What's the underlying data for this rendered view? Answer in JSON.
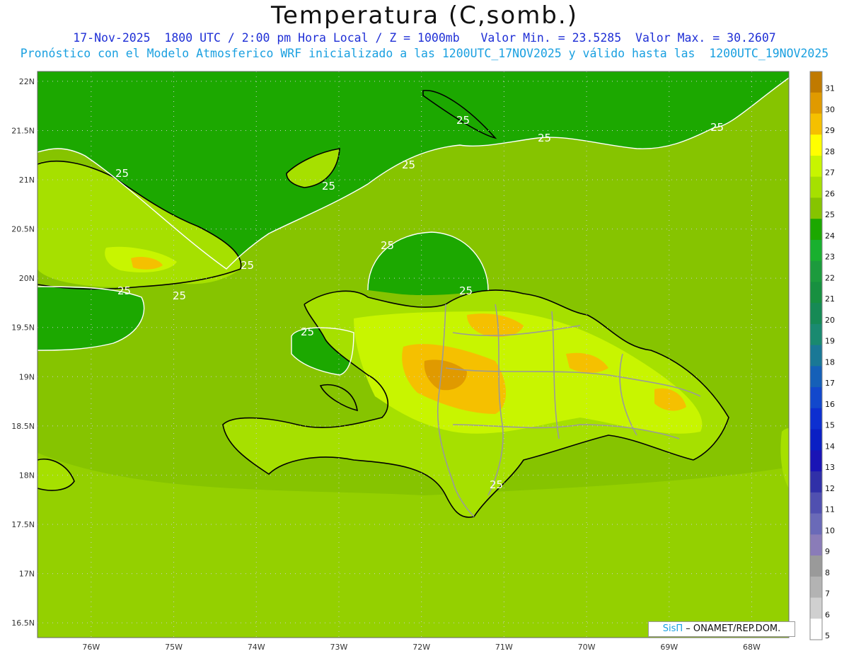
{
  "title": "Temperatura (C,somb.)",
  "subtitle1": "17-Nov-2025  1800 UTC / 2:00 pm Hora Local / Z = 1000mb   Valor Min. = 23.5285  Valor Max. = 30.2607",
  "subtitle2": "Pronóstico con el Modelo Atmosferico WRF inicializado a las 1200UTC_17NOV2025 y válido hasta las  1200UTC_19NOV2025",
  "credit": {
    "brand": "SisΠ",
    "text": " – ONAMET/REP.DOM."
  },
  "lat_labels": [
    "22N",
    "21.5N",
    "21N",
    "20.5N",
    "20N",
    "19.5N",
    "19N",
    "18.5N",
    "18N",
    "17.5N",
    "17N",
    "16.5N"
  ],
  "lon_labels": [
    "76W",
    "75W",
    "74W",
    "73W",
    "72W",
    "71W",
    "70W",
    "69W",
    "68W"
  ],
  "contour_label": "25",
  "colorbar": {
    "labels": [
      "31",
      "30",
      "29",
      "28",
      "27",
      "26",
      "25",
      "24",
      "23",
      "22",
      "21",
      "20",
      "19",
      "18",
      "17",
      "16",
      "15",
      "14",
      "13",
      "12",
      "11",
      "10",
      "9",
      "8",
      "7",
      "6",
      "5"
    ],
    "colors": [
      "#c07a00",
      "#e09a00",
      "#f5c000",
      "#ffff00",
      "#c8f500",
      "#a6e000",
      "#86c400",
      "#1ca800",
      "#19b02f",
      "#1c9b3d",
      "#179040",
      "#168a55",
      "#1a8a70",
      "#1a7896",
      "#1560b8",
      "#1248cc",
      "#0d2fd0",
      "#0a1fc4",
      "#1a14b5",
      "#3030a8",
      "#5050b0",
      "#6a6ab8",
      "#8a7cb8",
      "#9a9a9a",
      "#b3b3b3",
      "#d0d0d0",
      "#ffffff"
    ]
  },
  "colors": {
    "sea_deep": "#1ca800",
    "sea_mid": "#86c400",
    "sea_light": "#a6e000",
    "land_warm": "#c8f500",
    "land_hot": "#f5c000",
    "land_hotter": "#e09a00",
    "coast": "#000000",
    "border": "#9a9a9a",
    "contour": "#ffffff"
  }
}
